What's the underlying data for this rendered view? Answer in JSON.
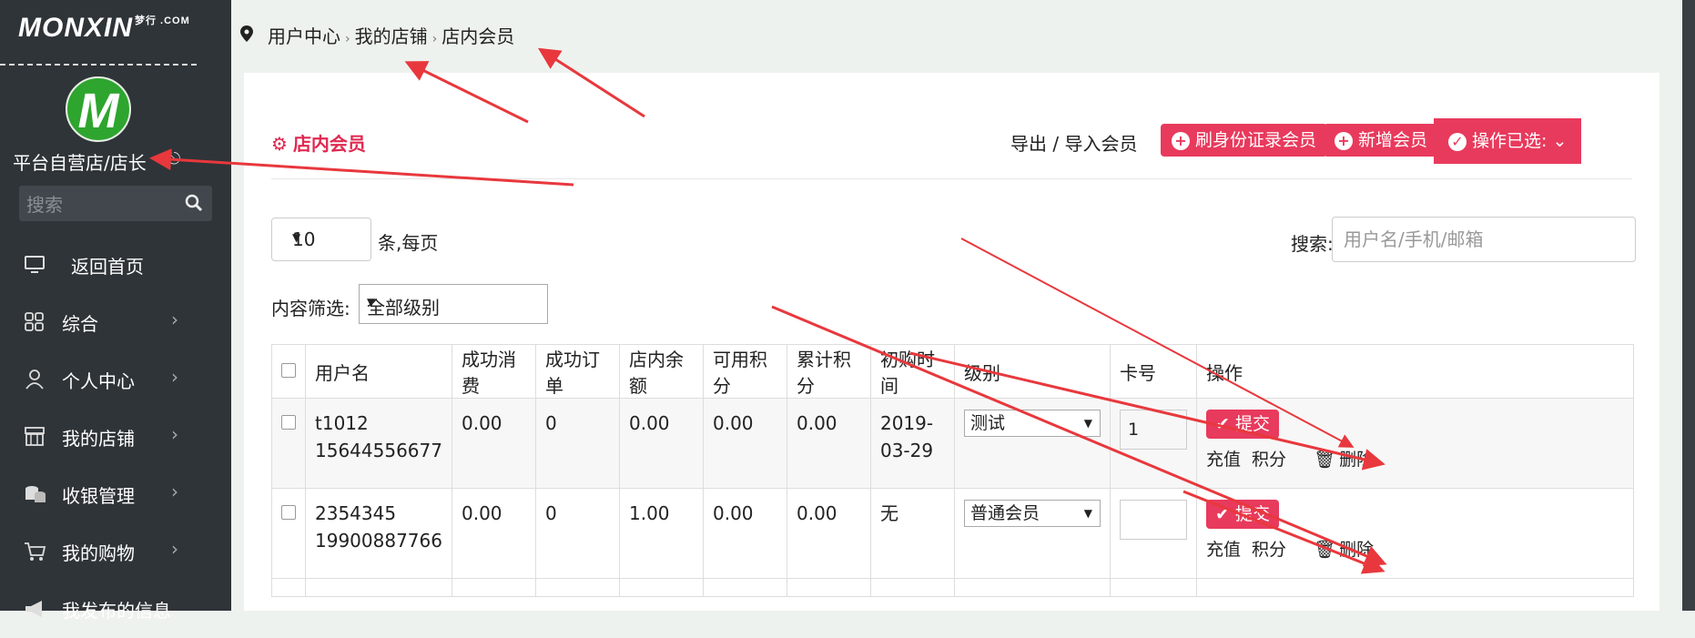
{
  "sidebar": {
    "logo": "MONXIN",
    "logo_sub": "梦行 .COM",
    "avatar_letter": "M",
    "shop_name": "平台自营店/店长",
    "search_placeholder": "搜索",
    "items": [
      {
        "label": "返回首页",
        "icon": "monitor-icon",
        "has_arrow": false
      },
      {
        "label": "综合",
        "icon": "grid-icon",
        "has_arrow": true
      },
      {
        "label": "个人中心",
        "icon": "user-icon",
        "has_arrow": true
      },
      {
        "label": "我的店铺",
        "icon": "store-icon",
        "has_arrow": true
      },
      {
        "label": "收银管理",
        "icon": "coins-icon",
        "has_arrow": true
      },
      {
        "label": "我的购物",
        "icon": "cart-icon",
        "has_arrow": true
      },
      {
        "label": "我发布的信息",
        "icon": "megaphone-icon",
        "has_arrow": false
      }
    ],
    "chevron": "›"
  },
  "breadcrumb": [
    "用户中心",
    "我的店铺",
    "店内会员"
  ],
  "panel": {
    "title": "店内会员",
    "export_label": "导出 / 导入会员",
    "id_card_btn": "刷身份证录会员",
    "add_btn": "新增会员",
    "ops_btn": "操作已选:"
  },
  "list": {
    "page_size": "10",
    "per_page_label": "条,每页",
    "search_label": "搜索:",
    "search_placeholder": "用户名/手机/邮箱",
    "filter_label": "内容筛选:",
    "filter_value": "全部级别"
  },
  "table": {
    "headers": [
      "用户名",
      "成功消费",
      "成功订单",
      "店内余额",
      "可用积分",
      "累计积分",
      "初购时间",
      "级别",
      "卡号",
      "操作"
    ],
    "rows": [
      {
        "user": "t1012",
        "phone": "15644556677",
        "spend": "0.00",
        "orders": "0",
        "balance": "0.00",
        "avail_points": "0.00",
        "total_points": "0.00",
        "first_date_a": "2019-",
        "first_date_b": "03-29",
        "level": "测试",
        "card": "1"
      },
      {
        "user": "2354345",
        "phone": "19900887766",
        "spend": "0.00",
        "orders": "0",
        "balance": "1.00",
        "avail_points": "0.00",
        "total_points": "0.00",
        "first_date_a": "无",
        "first_date_b": "",
        "level": "普通会员",
        "card": ""
      }
    ],
    "submit_label": "提交",
    "recharge_label": "充值",
    "points_label": "积分",
    "delete_label": "删除"
  },
  "colors": {
    "accent": "#e83a5d",
    "sidebar": "#2f3438",
    "annotation": "#e8383d"
  }
}
